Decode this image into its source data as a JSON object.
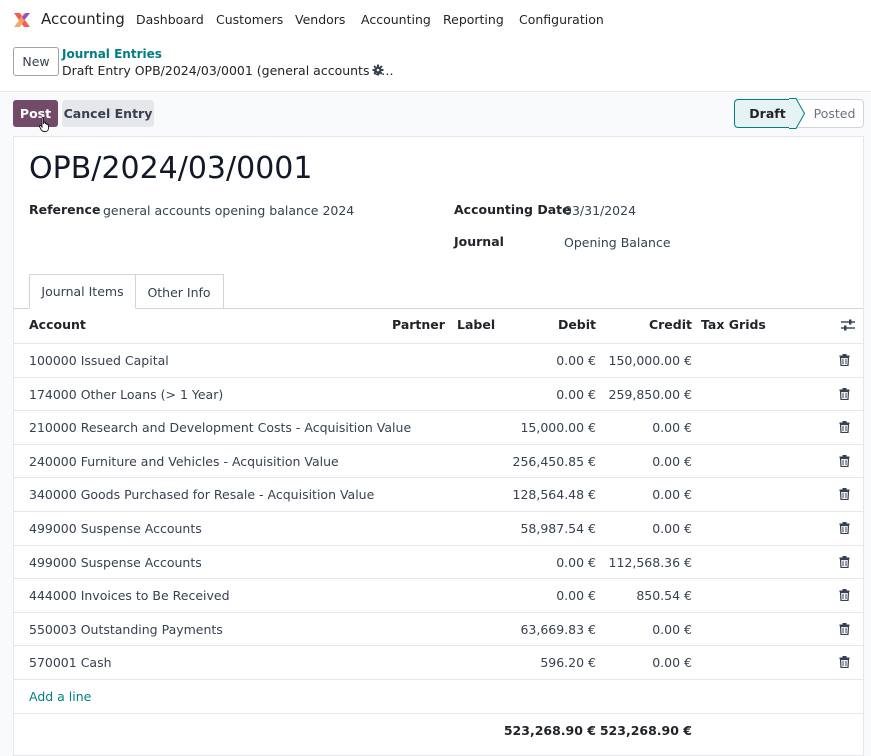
{
  "app": {
    "name": "Accounting",
    "menu": [
      "Dashboard",
      "Customers",
      "Vendors",
      "Accounting",
      "Reporting",
      "Configuration"
    ]
  },
  "control": {
    "new_label": "New",
    "breadcrumb_parent": "Journal Entries",
    "breadcrumb_current": "Draft Entry OPB/2024/03/0001 (general accounts o…"
  },
  "actions": {
    "post_label": "Post",
    "cancel_label": "Cancel Entry"
  },
  "status": {
    "steps": [
      "Draft",
      "Posted"
    ],
    "current": "Draft"
  },
  "form": {
    "title": "OPB/2024/03/0001",
    "reference_label": "Reference",
    "reference_value": "general accounts opening balance 2024",
    "date_label": "Accounting Date",
    "date_value": "03/31/2024",
    "journal_label": "Journal",
    "journal_value": "Opening Balance"
  },
  "tabs": [
    "Journal Items",
    "Other Info"
  ],
  "table": {
    "headers": {
      "account": "Account",
      "partner": "Partner",
      "label": "Label",
      "debit": "Debit",
      "credit": "Credit",
      "tax_grids": "Tax Grids"
    },
    "rows": [
      {
        "account": "100000 Issued Capital",
        "debit": "0.00 €",
        "credit": "150,000.00 €"
      },
      {
        "account": "174000 Other Loans (> 1 Year)",
        "debit": "0.00 €",
        "credit": "259,850.00 €"
      },
      {
        "account": "210000 Research and Development Costs - Acquisition Value",
        "debit": "15,000.00 €",
        "credit": "0.00 €"
      },
      {
        "account": "240000 Furniture and Vehicles - Acquisition Value",
        "debit": "256,450.85 €",
        "credit": "0.00 €"
      },
      {
        "account": "340000 Goods Purchased for Resale - Acquisition Value",
        "debit": "128,564.48 €",
        "credit": "0.00 €"
      },
      {
        "account": "499000 Suspense Accounts",
        "debit": "58,987.54 €",
        "credit": "0.00 €"
      },
      {
        "account": "499000 Suspense Accounts",
        "debit": "0.00 €",
        "credit": "112,568.36 €"
      },
      {
        "account": "444000 Invoices to Be Received",
        "debit": "0.00 €",
        "credit": "850.54 €"
      },
      {
        "account": "550003 Outstanding Payments",
        "debit": "63,669.83 €",
        "credit": "0.00 €"
      },
      {
        "account": "570001 Cash",
        "debit": "596.20 €",
        "credit": "0.00 €"
      }
    ],
    "add_line": "Add a line",
    "total_debit": "523,268.90 €",
    "total_credit": "523,268.90 €"
  },
  "colors": {
    "brand": "#714b67",
    "link": "#017e84"
  }
}
